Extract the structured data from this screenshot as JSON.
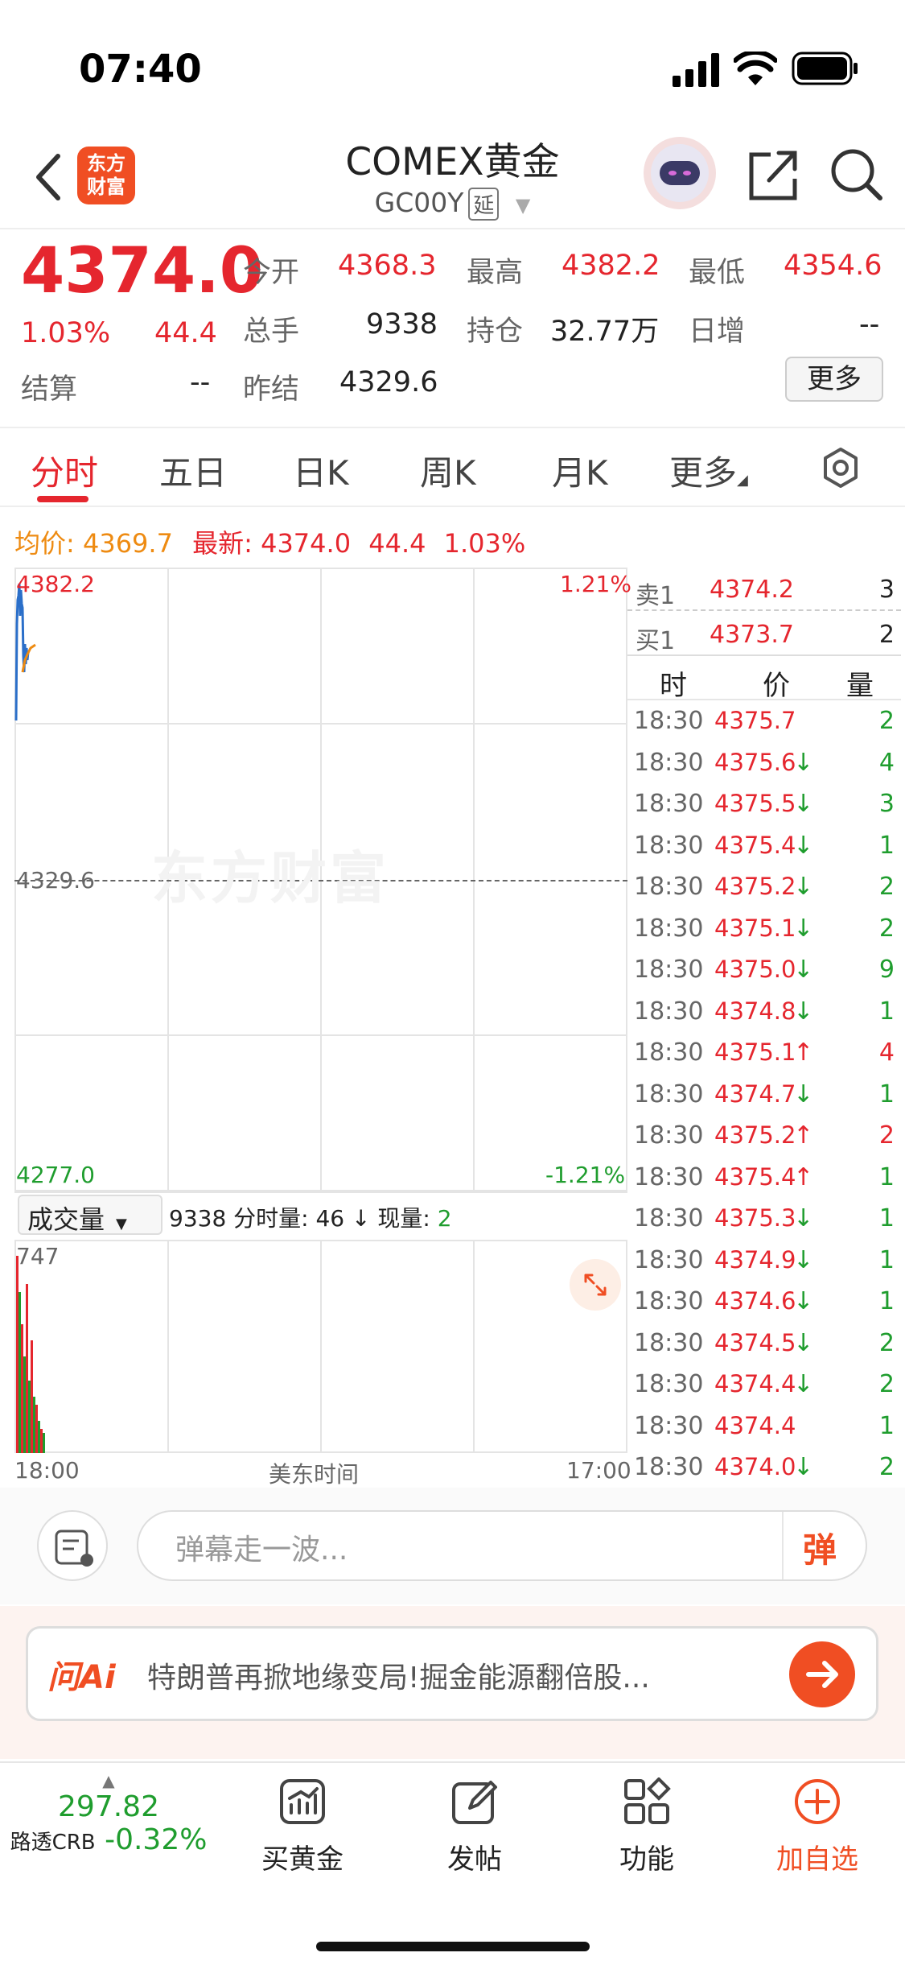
{
  "status": {
    "time": "07:40"
  },
  "nav": {
    "logo_line1": "东方",
    "logo_line2": "财富",
    "title": "COMEX黄金",
    "code": "GC00Y",
    "delay_tag": "延"
  },
  "quote": {
    "price": "4374.0",
    "change_pct": "1.03%",
    "change": "44.4",
    "settle_label": "结算",
    "settle_value": "--",
    "open_label": "今开",
    "open_value": "4368.3",
    "high_label": "最高",
    "high_value": "4382.2",
    "low_label": "最低",
    "low_value": "4354.6",
    "volume_label": "总手",
    "volume_value": "9338",
    "position_label": "持仓",
    "position_value": "32.77万",
    "daily_inc_label": "日增",
    "daily_inc_value": "--",
    "prev_settle_label": "昨结",
    "prev_settle_value": "4329.6",
    "more_button": "更多"
  },
  "tabs": [
    "分时",
    "五日",
    "日K",
    "周K",
    "月K",
    "更多"
  ],
  "summary": {
    "avg_label": "均价:",
    "avg_value": "4369.7",
    "latest_label": "最新:",
    "latest_value": "4374.0",
    "latest_change": "44.4",
    "latest_pct": "1.03%"
  },
  "chart": {
    "y_top": "4382.2",
    "y_mid": "4329.6",
    "y_bottom": "4277.0",
    "pct_top": "1.21%",
    "pct_bottom": "-1.21%",
    "watermark": "东方财富",
    "volume_selector": "成交量",
    "volume_info": "9338 分时量: 46 ↓ 现量:",
    "volume_current": "2",
    "volume_max": "747",
    "x_start": "18:00",
    "x_mid": "美东时间",
    "x_end": "17:00"
  },
  "orderbook": {
    "sell_label": "卖1",
    "sell_price": "4374.2",
    "sell_qty": "3",
    "buy_label": "买1",
    "buy_price": "4373.7",
    "buy_qty": "2"
  },
  "ticks_header": {
    "time": "时",
    "price": "价",
    "qty": "量"
  },
  "ticks": [
    {
      "time": "18:30",
      "price": "4375.7",
      "dir": "",
      "qty": "2",
      "qcolor": "green"
    },
    {
      "time": "18:30",
      "price": "4375.6",
      "dir": "↓",
      "qty": "4",
      "qcolor": "green"
    },
    {
      "time": "18:30",
      "price": "4375.5",
      "dir": "↓",
      "qty": "3",
      "qcolor": "green"
    },
    {
      "time": "18:30",
      "price": "4375.4",
      "dir": "↓",
      "qty": "1",
      "qcolor": "green"
    },
    {
      "time": "18:30",
      "price": "4375.2",
      "dir": "↓",
      "qty": "2",
      "qcolor": "green"
    },
    {
      "time": "18:30",
      "price": "4375.1",
      "dir": "↓",
      "qty": "2",
      "qcolor": "green"
    },
    {
      "time": "18:30",
      "price": "4375.0",
      "dir": "↓",
      "qty": "9",
      "qcolor": "green"
    },
    {
      "time": "18:30",
      "price": "4374.8",
      "dir": "↓",
      "qty": "1",
      "qcolor": "green"
    },
    {
      "time": "18:30",
      "price": "4375.1",
      "dir": "↑",
      "qty": "4",
      "qcolor": "red"
    },
    {
      "time": "18:30",
      "price": "4374.7",
      "dir": "↓",
      "qty": "1",
      "qcolor": "green"
    },
    {
      "time": "18:30",
      "price": "4375.2",
      "dir": "↑",
      "qty": "2",
      "qcolor": "red"
    },
    {
      "time": "18:30",
      "price": "4375.4",
      "dir": "↑",
      "qty": "1",
      "qcolor": "green"
    },
    {
      "time": "18:30",
      "price": "4375.3",
      "dir": "↓",
      "qty": "1",
      "qcolor": "green"
    },
    {
      "time": "18:30",
      "price": "4374.9",
      "dir": "↓",
      "qty": "1",
      "qcolor": "green"
    },
    {
      "time": "18:30",
      "price": "4374.6",
      "dir": "↓",
      "qty": "1",
      "qcolor": "green"
    },
    {
      "time": "18:30",
      "price": "4374.5",
      "dir": "↓",
      "qty": "2",
      "qcolor": "green"
    },
    {
      "time": "18:30",
      "price": "4374.4",
      "dir": "↓",
      "qty": "2",
      "qcolor": "green"
    },
    {
      "time": "18:30",
      "price": "4374.4",
      "dir": "",
      "qty": "1",
      "qcolor": "green"
    },
    {
      "time": "18:30",
      "price": "4374.0",
      "dir": "↓",
      "qty": "2",
      "qcolor": "green"
    }
  ],
  "comment": {
    "placeholder": "弹幕走一波...",
    "danmu_button": "弹"
  },
  "banner": {
    "badge": "问Ai",
    "text": "特朗普再掀地缘变局!掘金能源翻倍股..."
  },
  "bottom": {
    "index_value": "297.82",
    "index_name": "路透CRB",
    "index_change": "-0.32%",
    "buy_gold": "买黄金",
    "post": "发帖",
    "functions": "功能",
    "add_watch": "加自选"
  },
  "colors": {
    "up": "#e5262e",
    "down": "#1f9d2e",
    "accent": "#f04e23",
    "avg_line": "#ee8b12"
  }
}
